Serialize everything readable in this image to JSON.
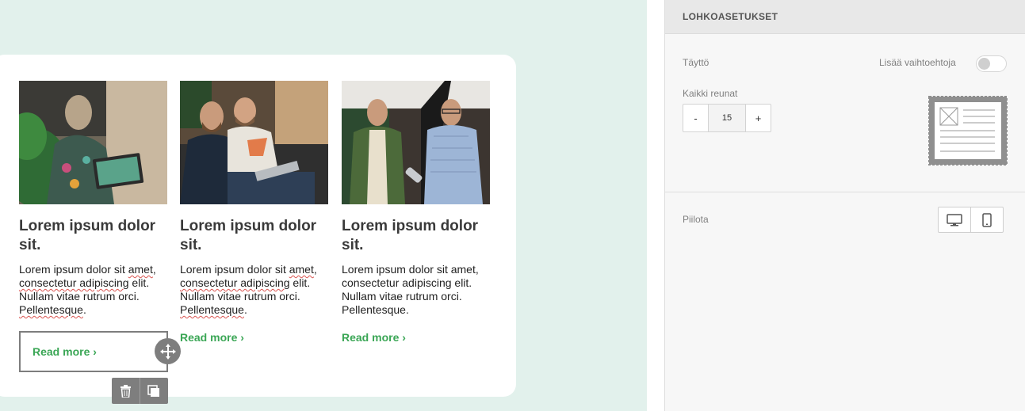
{
  "cards": [
    {
      "title": "Lorem ipsum dolor sit.",
      "text_a": "Lorem ipsum dolor sit ",
      "text_b": "amet",
      "text_c": ", ",
      "text_d": "consectetur adipiscing",
      "text_e": " elit. Nullam vitae rutrum orci. ",
      "text_f": "Pellentesque",
      "text_g": ".",
      "link": "Read more ›"
    },
    {
      "title": "Lorem ipsum dolor sit.",
      "text_a": "Lorem ipsum dolor sit ",
      "text_b": "amet",
      "text_c": ", ",
      "text_d": "consectetur adipiscing",
      "text_e": " elit. Nullam vitae rutrum orci. ",
      "text_f": "Pellentesque",
      "text_g": ".",
      "link": "Read more ›"
    },
    {
      "title": "Lorem ipsum dolor sit.",
      "text": "Lorem ipsum dolor sit amet, consectetur adipiscing elit. Nullam vitae rutrum orci. Pellentesque.",
      "link": "Read more ›"
    }
  ],
  "icons": {
    "move": "move-icon",
    "delete": "trash-icon",
    "duplicate": "duplicate-icon",
    "desktop": "desktop-icon",
    "mobile": "mobile-icon"
  },
  "panel": {
    "header": "LOHKOASETUKSET",
    "padding_label": "Täyttö",
    "more_options_label": "Lisää vaihtoehtoja",
    "more_options_on": false,
    "all_edges_label": "Kaikki reunat",
    "minus": "-",
    "value": "15",
    "plus": "+",
    "hide_label": "Piilota"
  },
  "colors": {
    "canvas_bg": "#e2f1ec",
    "link_green": "#3aa655",
    "tool_gray": "#7e7e7e"
  }
}
